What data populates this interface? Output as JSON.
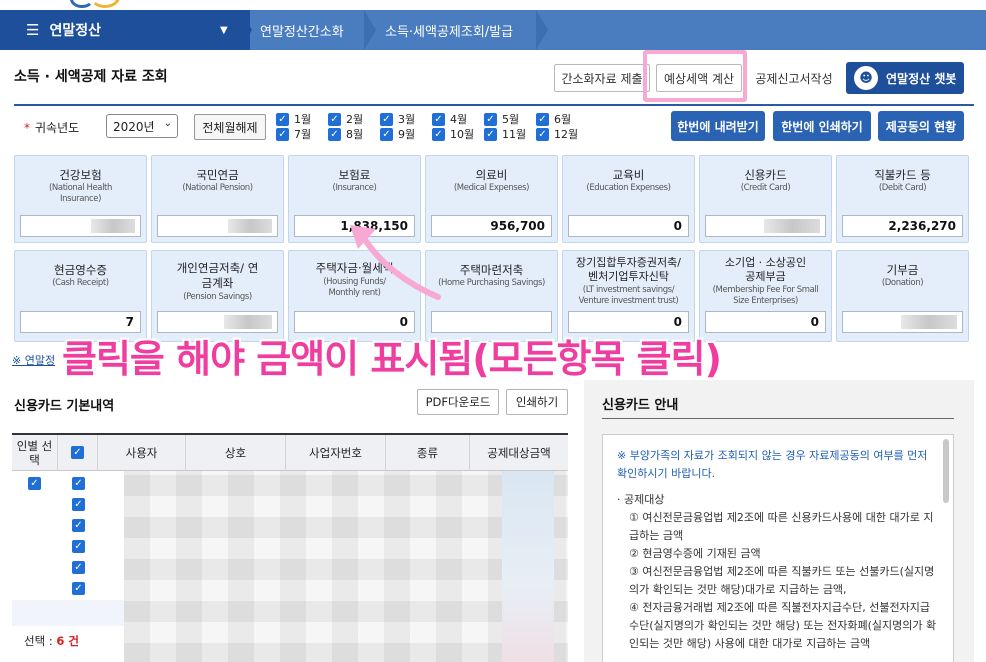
{
  "nav": {
    "main_label": "연말정산",
    "crumbs": [
      "연말정산간소화",
      "소득·세액공제조회/발급"
    ]
  },
  "header": {
    "title": "소득 · 세액공제 자료 조회",
    "buttons": [
      "간소화자료 제출",
      "예상세액 계산",
      "공제신고서작성"
    ],
    "chatbot_label": "연말정산 챗봇"
  },
  "filter": {
    "year_label": "귀속년도",
    "required_mark": "*",
    "year_value": "2020년",
    "clear_button": "전체월해제",
    "months": [
      "1월",
      "2월",
      "3월",
      "4월",
      "5월",
      "6월",
      "7월",
      "8월",
      "9월",
      "10월",
      "11월",
      "12월"
    ],
    "actions": [
      "한번에 내려받기",
      "한번에 인쇄하기",
      "제공동의 현황"
    ]
  },
  "cards_row1": [
    {
      "title": "건강보험",
      "sub": "(National Health Insurance)",
      "value": ""
    },
    {
      "title": "국민연금",
      "sub": "(National Pension)",
      "value": ""
    },
    {
      "title": "보험료",
      "sub": "(Insurance)",
      "value": "1,838,150"
    },
    {
      "title": "의료비",
      "sub": "(Medical Expenses)",
      "value": "956,700"
    },
    {
      "title": "교육비",
      "sub": "(Education Expenses)",
      "value": "0"
    },
    {
      "title": "신용카드",
      "sub": "(Credit Card)",
      "value": ""
    },
    {
      "title": "직불카드 등",
      "sub": "(Debit Card)",
      "value": "2,236,270"
    }
  ],
  "cards_row2": [
    {
      "title": "현금영수증",
      "sub": "(Cash Receipt)",
      "value": "7"
    },
    {
      "title": "개인연금저축/ 연금계좌",
      "sub": "(Pension Savings)",
      "value": ""
    },
    {
      "title": "주택자금·월세액",
      "sub": "(Housing Funds/ Monthly rent)",
      "value": "0"
    },
    {
      "title": "주택마련저축",
      "sub": "(Home Purchasing Savings)",
      "value": ""
    },
    {
      "title": "장기집합투자증권저축/ 벤처기업투자신탁",
      "sub": "(LT investment savings/ Venture investment trust)",
      "value": "0"
    },
    {
      "title": "소기업 · 소상공인 공제부금",
      "sub": "(Membership Fee For Small Size Enterprises)",
      "value": "0"
    },
    {
      "title": "기부금",
      "sub": "(Donation)",
      "value": ""
    }
  ],
  "notice": "※ 연말정",
  "overlay": "클릭을 해야 금액이 표시됨(모든항목 클릭)",
  "list": {
    "title": "신용카드 기본내역",
    "pdf_button": "PDF다운로드",
    "print_button": "인쇄하기",
    "columns": [
      "인별 선택",
      "사용자",
      "상호",
      "사업자번호",
      "종류",
      "공제대상금액"
    ],
    "row_count": 6,
    "select_label": "선택 : ",
    "select_value": "6 건"
  },
  "guide": {
    "title": "신용카드 안내",
    "warning": "※ 부양가족의 자료가 조회되지 않는 경우 자료제공동의 여부를 먼저 확인하시기 바랍니다.",
    "section": "공제대상",
    "items": [
      "① 여신전문금융업법 제2조에 따른 신용카드사용에 대한 대가로 지급하는 금액",
      "② 현금영수증에 기재된 금액",
      "③ 여신전문금융업법 제2조에 따른 직불카드 또는 선불카드(실지명의가 확인되는 것만 해당)대가로 지급하는 금액,",
      "④ 전자금융거래법 제2조에 따른 직불전자지급수단, 선불전자지급수단(실지명의가 확인되는 것만 해당) 또는 전자화폐(실지명의가 확인되는 것만 해당) 사용에 대한 대가로 지급하는 금액"
    ]
  }
}
